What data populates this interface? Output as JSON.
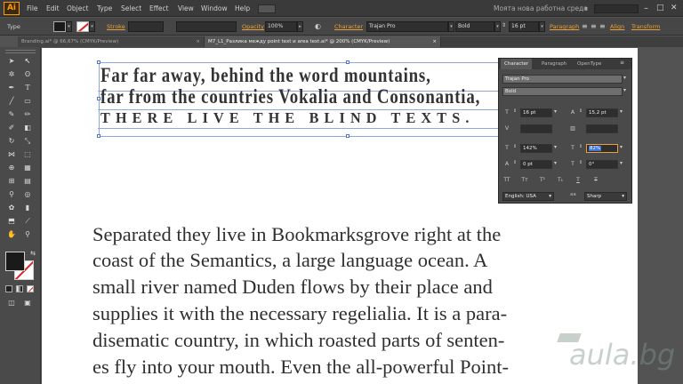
{
  "app": {
    "logo": "Ai",
    "workspace": "Моята нова работна среда"
  },
  "menu": [
    "File",
    "Edit",
    "Object",
    "Type",
    "Select",
    "Effect",
    "View",
    "Window",
    "Help"
  ],
  "control": {
    "type_label": "Type",
    "stroke_label": "Stroke",
    "opacity_label": "Opacity",
    "opacity_value": "100%",
    "character_label": "Character",
    "font_family": "Trajan Pro",
    "font_style": "Bold",
    "font_size": "16 pt",
    "paragraph_label": "Paragraph",
    "align_label": "Align",
    "transform_label": "Transform"
  },
  "tabs": [
    {
      "label": "Branding.ai* @ 66,67% (CMYK/Preview)",
      "active": false
    },
    {
      "label": "M7_L1_Разлика между point text и area text.ai* @ 200% (CMYK/Preview)",
      "active": true
    }
  ],
  "canvas": {
    "heading_lines": [
      "Far far away, behind the word mountains,",
      "far from the countries Vokalia and Consonantia,",
      "there live the blind texts."
    ],
    "body_lines": [
      "Separated they live in Bookmarksgrove right at the",
      "coast of the Semantics, a large language ocean. A",
      "small river named Duden flows by their place and",
      "supplies it with the necessary regelialia. It is a para-",
      "disematic country, in which roasted parts of senten-",
      "es fly into your mouth. Even the all-powerful Point-"
    ]
  },
  "character_panel": {
    "tabs": [
      "Character",
      "Paragraph",
      "OpenType"
    ],
    "font_family": "Trajan Pro",
    "font_style": "Bold",
    "size": "16 pt",
    "leading": "15,2 pt",
    "kerning": "",
    "tracking": "",
    "vertical_scale": "142%",
    "horizontal_scale": "82%",
    "baseline_shift": "0 pt",
    "rotation": "0°",
    "language": "English: USA",
    "antialias_label": "aa",
    "antialias": "Sharp"
  },
  "watermark": "aula.bg"
}
